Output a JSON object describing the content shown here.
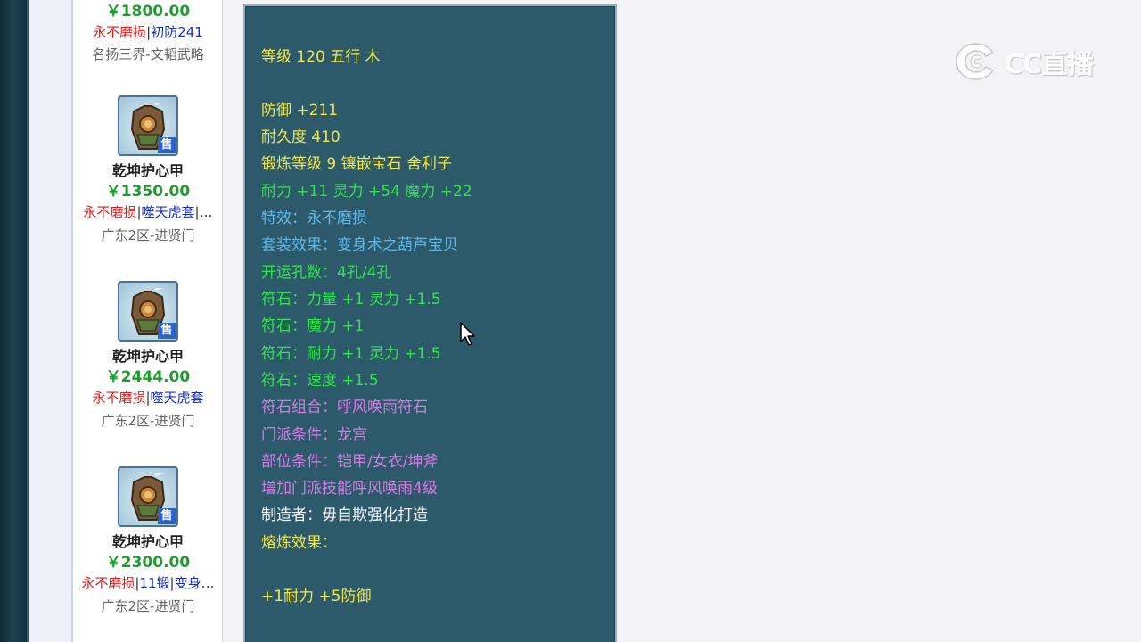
{
  "listing": {
    "items": [
      {
        "name": "",
        "price": "￥1800.00",
        "tags": [
          {
            "text": "永不磨损",
            "color": "red"
          },
          {
            "text": "|",
            "color": "sep"
          },
          {
            "text": "初防241",
            "color": "blue"
          }
        ],
        "server": "名扬三界-文韬武略",
        "sell_badge": ""
      },
      {
        "name": "乾坤护心甲",
        "price": "￥1350.00",
        "tags": [
          {
            "text": "永不磨损",
            "color": "red"
          },
          {
            "text": "|",
            "color": "sep"
          },
          {
            "text": "噬天虎套",
            "color": "blue"
          },
          {
            "text": "|…",
            "color": "sep"
          }
        ],
        "server": "广东2区-进贤门",
        "sell_badge": "售"
      },
      {
        "name": "乾坤护心甲",
        "price": "￥2444.00",
        "tags": [
          {
            "text": "永不磨损",
            "color": "red"
          },
          {
            "text": "|",
            "color": "sep"
          },
          {
            "text": "噬天虎套",
            "color": "blue"
          }
        ],
        "server": "广东2区-进贤门",
        "sell_badge": "售"
      },
      {
        "name": "乾坤护心甲",
        "price": "￥2300.00",
        "tags": [
          {
            "text": "永不磨损",
            "color": "red"
          },
          {
            "text": "|",
            "color": "sep"
          },
          {
            "text": "11锻",
            "color": "blue"
          },
          {
            "text": "|",
            "color": "sep"
          },
          {
            "text": "变身…",
            "color": "blue"
          }
        ],
        "server": "广东2区-进贤门",
        "sell_badge": "售"
      }
    ]
  },
  "detail": {
    "lines": [
      {
        "text": "等级 120 五行 木",
        "color": "yellow"
      },
      {
        "text": "防御 +211",
        "color": "yellow"
      },
      {
        "text": "耐久度 410",
        "color": "yellow"
      },
      {
        "text": "锻炼等级 9 镶嵌宝石 舍利子",
        "color": "yellow"
      },
      {
        "text": "耐力 +11 灵力 +54 魔力 +22",
        "color": "green"
      },
      {
        "text": "特效：永不磨损",
        "color": "cyan"
      },
      {
        "text": "套装效果：变身术之葫芦宝贝",
        "color": "cyan"
      },
      {
        "text": "开运孔数：4孔/4孔",
        "color": "green"
      },
      {
        "text": "符石：力量 +1 灵力 +1.5",
        "color": "green"
      },
      {
        "text": "符石：魔力 +1",
        "color": "green"
      },
      {
        "text": "符石：耐力 +1 灵力 +1.5",
        "color": "green"
      },
      {
        "text": "符石：速度 +1.5",
        "color": "green"
      },
      {
        "text": "符石组合：呼风唤雨符石",
        "color": "purple"
      },
      {
        "text": "门派条件：龙宫",
        "color": "purple"
      },
      {
        "text": "部位条件：铠甲/女衣/坤斧",
        "color": "purple"
      },
      {
        "text": "增加门派技能呼风唤雨4级",
        "color": "purple"
      },
      {
        "text": "制造者：毋自欺强化打造",
        "color": "white"
      },
      {
        "text": "熔炼效果：",
        "color": "yellow"
      },
      {
        "text": "+1耐力 +5防御",
        "color": "yellow"
      }
    ]
  },
  "watermark": {
    "text": "CC直播",
    "logo_icon": "cc-logo-icon"
  },
  "colors": {
    "red": "#e01b1b",
    "blue": "#1830c0",
    "green_price": "#1e9c2f",
    "panel_bg": "#2d5a6a",
    "yellow": "#f2e74a",
    "green": "#2fe54a",
    "cyan": "#5fb8e8",
    "purple": "#d67ae6",
    "white": "#f4f4f4"
  }
}
